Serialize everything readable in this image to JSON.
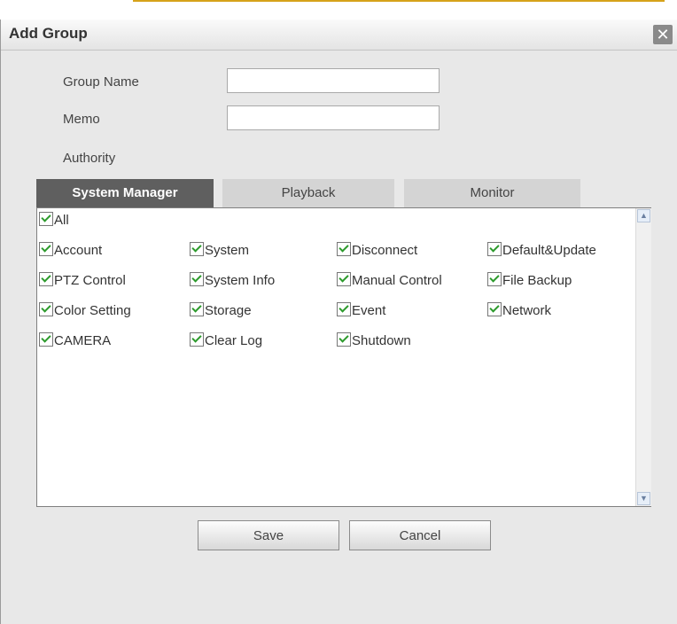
{
  "dialog": {
    "title": "Add Group",
    "close_glyph": "✕"
  },
  "form": {
    "group_name": {
      "label": "Group Name",
      "value": "",
      "placeholder": ""
    },
    "memo": {
      "label": "Memo",
      "value": "",
      "placeholder": ""
    },
    "authority_label": "Authority"
  },
  "tabs": [
    "System Manager",
    "Playback",
    "Monitor"
  ],
  "active_tab": "System Manager",
  "permissions": {
    "all": {
      "label": "All",
      "checked": true
    },
    "items": [
      {
        "label": "Account",
        "checked": true
      },
      {
        "label": "System",
        "checked": true
      },
      {
        "label": "Disconnect",
        "checked": true
      },
      {
        "label": "Default&Update",
        "checked": true
      },
      {
        "label": "PTZ Control",
        "checked": true
      },
      {
        "label": "System Info",
        "checked": true
      },
      {
        "label": "Manual Control",
        "checked": true
      },
      {
        "label": "File Backup",
        "checked": true
      },
      {
        "label": "Color Setting",
        "checked": true
      },
      {
        "label": "Storage",
        "checked": true
      },
      {
        "label": "Event",
        "checked": true
      },
      {
        "label": "Network",
        "checked": true
      },
      {
        "label": "CAMERA",
        "checked": true
      },
      {
        "label": "Clear Log",
        "checked": true
      },
      {
        "label": "Shutdown",
        "checked": true
      }
    ]
  },
  "buttons": {
    "save": "Save",
    "cancel": "Cancel"
  },
  "colors": {
    "accent_strip": "#d6a21a",
    "active_tab": "#5f5f5f",
    "inactive_tab": "#d4d4d4",
    "check": "#2c9a2c"
  }
}
